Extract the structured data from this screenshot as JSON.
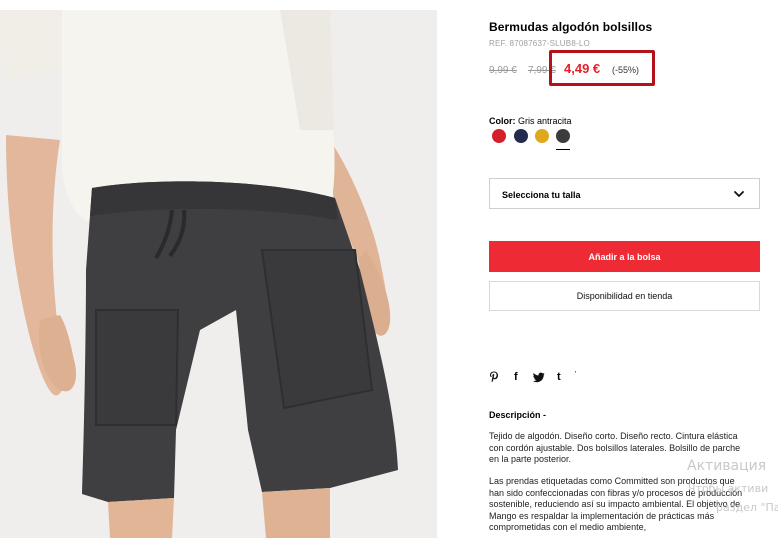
{
  "product": {
    "title": "Bermudas algodón bolsillos",
    "ref": "REF. 87087637-SLUB8-LO"
  },
  "pricing": {
    "old_price_1": "9,99 €",
    "old_price_2": "7,99 €",
    "sale_price": "4,49 €",
    "discount": "(-55%)",
    "sale_color": "#e5202c",
    "highlight_color": "#b3121a"
  },
  "color": {
    "label": "Color:",
    "selected_name": "Gris antracita",
    "swatches": [
      {
        "name": "red",
        "hex": "#d4202a"
      },
      {
        "name": "navy",
        "hex": "#232c4e"
      },
      {
        "name": "mustard",
        "hex": "#e0a81c"
      },
      {
        "name": "anthracite",
        "hex": "#3c3c3c",
        "selected": true
      }
    ]
  },
  "size_select": {
    "label": "Selecciona tu talla",
    "icon": "chevron-down-icon"
  },
  "actions": {
    "add_to_bag": "Añadir a la bolsa",
    "add_to_bag_color": "#ee2b35",
    "store_availability": "Disponibilidad en tienda"
  },
  "social": {
    "icons": [
      "pinterest-icon",
      "facebook-icon",
      "twitter-icon",
      "tumblr-icon"
    ],
    "glyphs": [
      "P",
      "f",
      "🐦",
      "t"
    ]
  },
  "description": {
    "title": "Descripción -",
    "paragraph_1": "Tejido de algodón. Diseño corto. Diseño recto. Cintura elástica con cordón ajustable. Dos bolsillos laterales. Bolsillo de parche en la parte posterior.",
    "paragraph_2": "Las prendas etiquetadas como Committed son productos que han sido confeccionadas con fibras y/o procesos de producción sostenible, reduciendo así su impacto ambiental. El objetivo de Mango es respaldar la implementación de prácticas más comprometidas con el medio ambiente,"
  },
  "watermark": {
    "line_1": "Активация",
    "line_2": "Чтобы активи",
    "line_3": "раздел \"Пара"
  }
}
